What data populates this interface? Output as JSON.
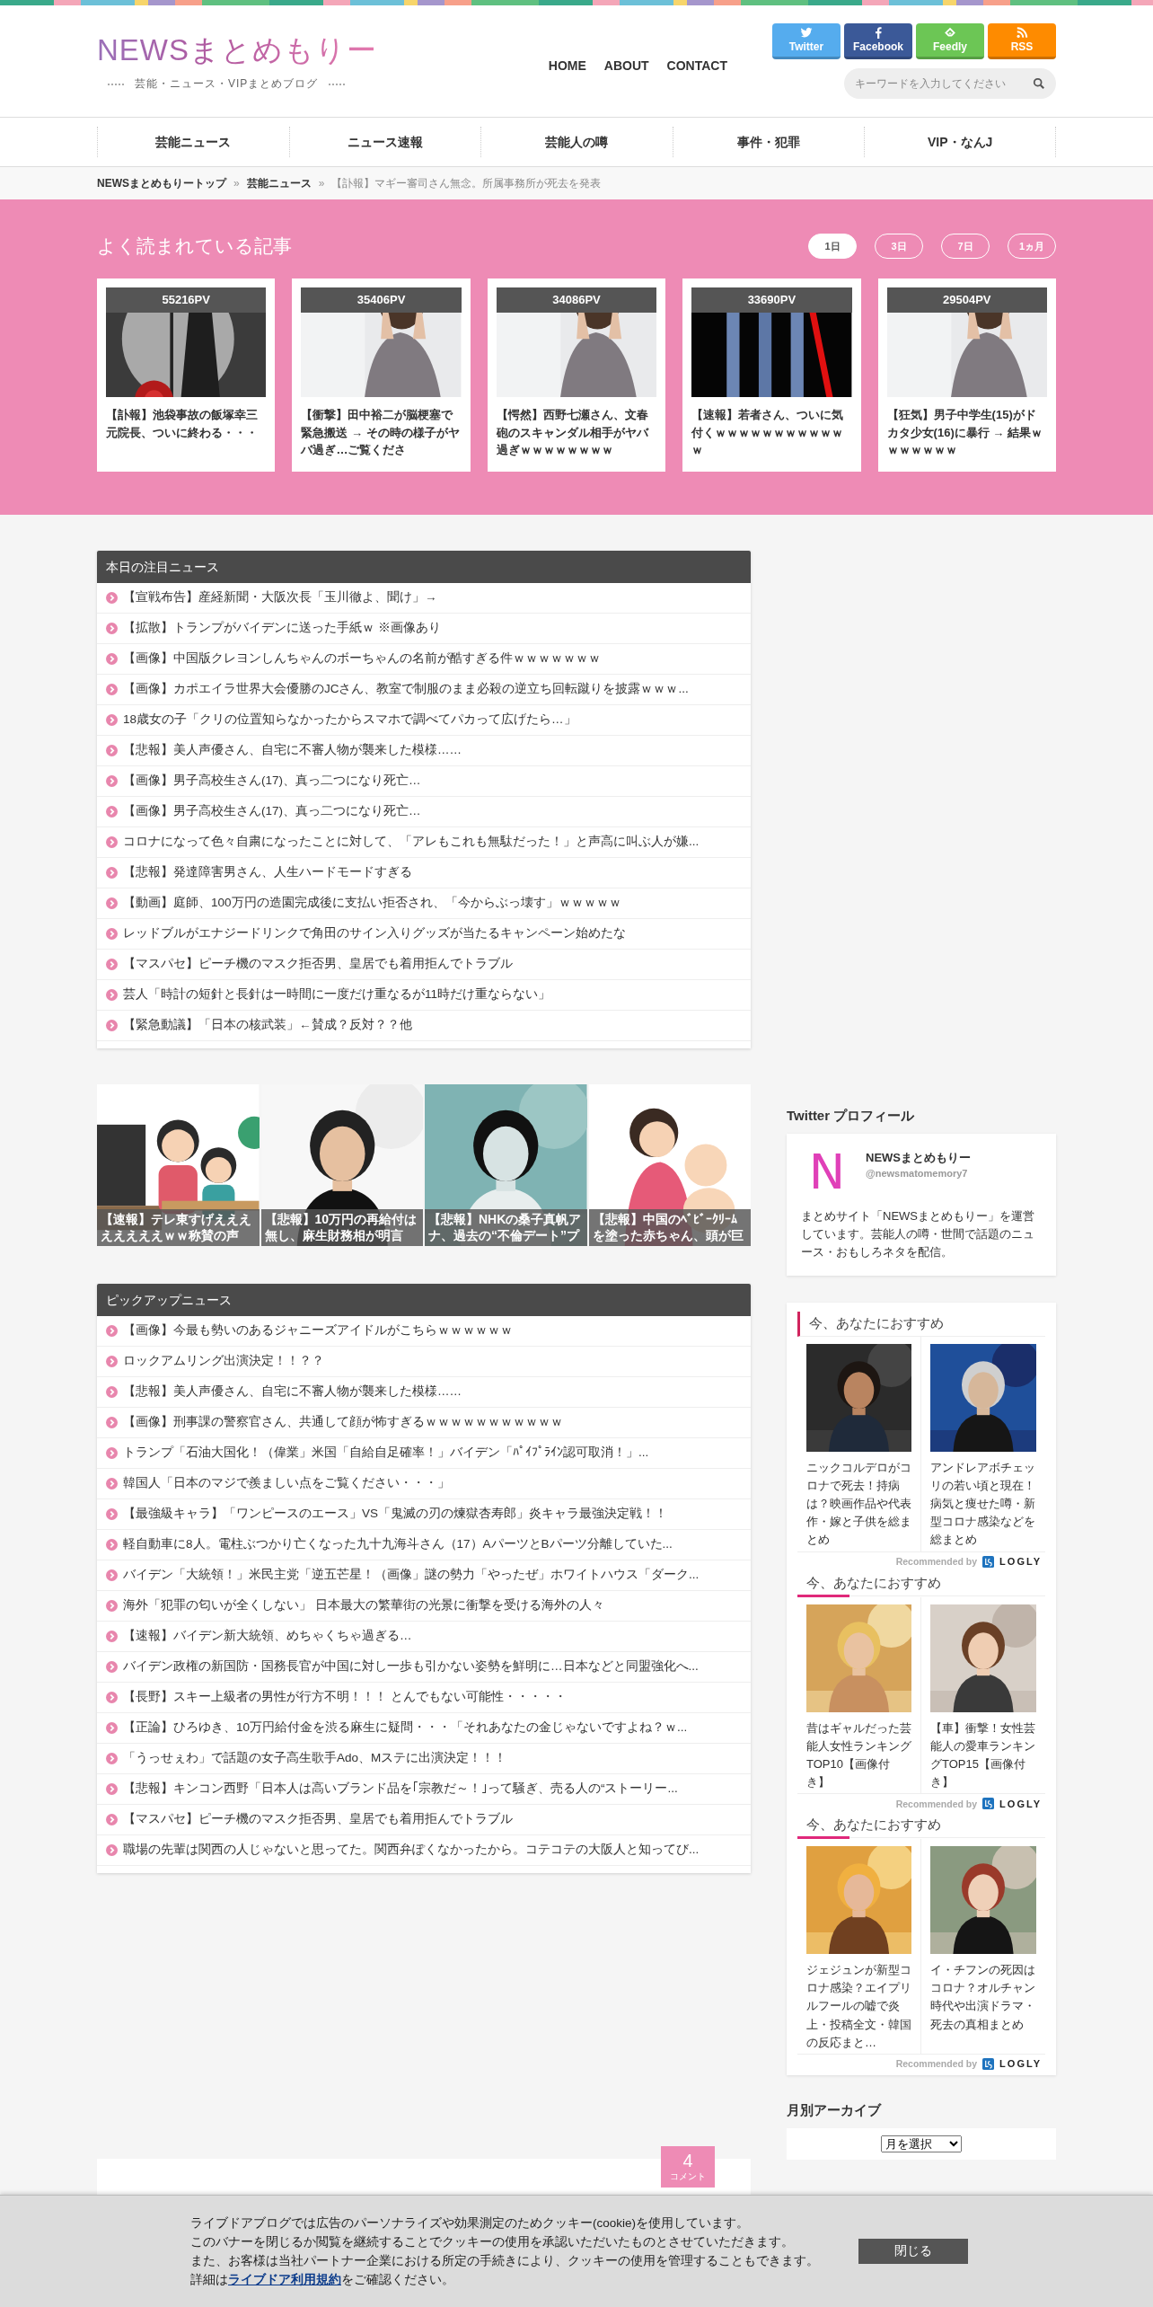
{
  "header": {
    "logo": "NEWSまとめもりー",
    "tagline": "芸能・ニュース・VIPまとめブログ",
    "links": [
      "HOME",
      "ABOUT",
      "CONTACT"
    ],
    "social": [
      {
        "kind": "twitter",
        "label": "Twitter",
        "color": "#55acee"
      },
      {
        "kind": "facebook",
        "label": "Facebook",
        "color": "#3b5998"
      },
      {
        "kind": "feedly",
        "label": "Feedly",
        "color": "#6cc655"
      },
      {
        "kind": "rss",
        "label": "RSS",
        "color": "#fe8b00"
      }
    ],
    "search": {
      "placeholder": "キーワードを入力してください"
    }
  },
  "category_nav": [
    "芸能ニュース",
    "ニュース速報",
    "芸能人の噂",
    "事件・犯罪",
    "VIP・なんJ"
  ],
  "breadcrumb": {
    "separator": "»",
    "links": [
      "NEWSまとめもりートップ",
      "芸能ニュース"
    ],
    "current": "【訃報】マギー審司さん無念。所属事務所が死去を発表"
  },
  "popular": {
    "title": "よく読まれている記事",
    "tabs": [
      {
        "label": "1日",
        "selected": true
      },
      {
        "label": "3日",
        "selected": false
      },
      {
        "label": "7日",
        "selected": false
      },
      {
        "label": "1ヵ月",
        "selected": false
      }
    ],
    "articles": [
      {
        "views": "55216PV",
        "title": "【訃報】池袋事故の飯塚幸三元院長、ついに終わる・・・"
      },
      {
        "views": "35406PV",
        "title": "【衝撃】田中裕二が脳梗塞で緊急搬送 → その時の様子がヤバ過ぎ…ご覧くださ"
      },
      {
        "views": "34086PV",
        "title": "【愕然】西野七瀬さん、文春砲のスキャンダル相手がヤバ過ぎｗｗｗｗｗｗｗｗ"
      },
      {
        "views": "33690PV",
        "title": "【速報】若者さん、ついに気付くｗｗｗｗｗｗｗｗｗｗｗｗ"
      },
      {
        "views": "29504PV",
        "title": "【狂気】男子中学生(15)がドカタ少女(16)に暴行 → 結果ｗｗｗｗｗｗｗ"
      }
    ]
  },
  "todays_news": {
    "title": "本日の注目ニュース",
    "items": [
      "【宣戦布告】産経新聞・大阪次長「玉川徹よ、聞け」→",
      "【拡散】トランプがバイデンに送った手紙ｗ ※画像あり",
      "【画像】中国版クレヨンしんちゃんのボーちゃんの名前が酷すぎる件ｗｗｗｗｗｗｗ",
      "【画像】カポエイラ世界大会優勝のJCさん、教室で制服のまま必殺の逆立ち回転蹴りを披露ｗｗｗ...",
      "18歳女の子「クリの位置知らなかったからスマホで調べてパカって広げたら…」",
      "【悲報】美人声優さん、自宅に不審人物が襲来した模様……",
      "【画像】男子高校生さん(17)、真っ二つになり死亡…",
      "【画像】男子高校生さん(17)、真っ二つになり死亡…",
      "コロナになって色々自粛になったことに対して、「アレもこれも無駄だった！」と声高に叫ぶ人が嫌...",
      "【悲報】発達障害男さん、人生ハードモードすぎる",
      "【動画】庭師、100万円の造園完成後に支払い拒否され、「今からぶっ壊す」ｗｗｗｗｗ",
      "レッドブルがエナジードリンクで角田のサイン入りグッズが当たるキャンペーン始めたな",
      "【マスパセ】ピーチ機のマスク拒否男、皇居でも着用拒んでトラブル",
      "芸人「時計の短針と長針は一時間に一度だけ重なるが11時だけ重ならない」",
      "【緊急動議】「日本の核武装」←賛成？反対？？他"
    ]
  },
  "image_strip": [
    {
      "caption": "【速報】テレ東すげええええええええｗｗ称賛の声"
    },
    {
      "caption": "【悲報】10万円の再給付は無し、麻生財務相が明言"
    },
    {
      "caption": "【悲報】NHKの桑子真帆アナ、過去の“不倫デート”プ"
    },
    {
      "caption": "【悲報】中国のﾍﾞﾋﾞｰｸﾘｰﾑを塗った赤ちゃん、頭が巨"
    }
  ],
  "pickup_news": {
    "title": "ピックアップニュース",
    "items": [
      "【画像】今最も勢いのあるジャニーズアイドルがこちらｗｗｗｗｗｗ",
      "ロックアムリング出演決定！！？？",
      "【悲報】美人声優さん、自宅に不審人物が襲来した模様……",
      "【画像】刑事課の警察官さん、共通して顔が怖すぎるｗｗｗｗｗｗｗｗｗｗｗ",
      "トランプ「石油大国化！（偉業」米国「自給自足確率！」バイデン「ﾊﾟｲﾌﾟﾗｲﾝ認可取消！」...",
      "韓国人「日本のマジで羨ましい点をご覧ください・・・」",
      "【最強級キャラ】「ワンピースのエース」VS「鬼滅の刃の煉獄杏寿郎」炎キャラ最強決定戦！！",
      "軽自動車に8人。電柱ぶつかり亡くなった九十九海斗さん（17）AパーツとBパーツ分離していた...",
      "バイデン「大統領！」米民主党「逆五芒星！（画像」謎の勢力「やったぜ」ホワイトハウス「ダーク...",
      "海外「犯罪の匂いが全くしない」 日本最大の繁華街の光景に衝撃を受ける海外の人々",
      "【速報】バイデン新大統領、めちゃくちゃ過ぎる…",
      "バイデン政権の新国防・国務長官が中国に対し一歩も引かない姿勢を鮮明に…日本などと同盟強化へ...",
      "【長野】スキー上級者の男性が行方不明！！！ とんでもない可能性・・・・・",
      "【正論】ひろゆき、10万円給付金を渋る麻生に疑問・・・「それあなたの金じゃないですよね？ｗ...",
      "「うっせぇわ」で話題の女子高生歌手Ado、Mステに出演決定！！！",
      "【悲報】キンコン西野「日本人は高いブランド品を｢宗教だ～！｣って騒ぎ、売る人の“ストーリー...",
      "【マスパセ】ピーチ機のマスク拒否男、皇居でも着用拒んでトラブル",
      "職場の先輩は関西の人じゃないと思ってた。関西弁ぽくなかったから。コテコテの大阪人と知ってび..."
    ]
  },
  "article": {
    "comments": {
      "count": "4",
      "label": "コメント"
    }
  },
  "twitter_profile": {
    "title": "Twitter プロフィール",
    "avatar_letter": "N",
    "name": "NEWSまとめもりー",
    "handle": "@newsmatomemory7",
    "bio": "まとめサイト「NEWSまとめもりー」を運営しています。芸能人の噂・世間で話題のニュース・おもしろネタを配信。"
  },
  "recommendations": [
    {
      "heading": "今、あなたにおすすめ",
      "kind": "bar",
      "items": [
        {
          "title": "ニックコルデロがコロナで死去！持病は？映画作品や代表作・嫁と子供を総まとめ"
        },
        {
          "title": "アンドレアボチェッリの若い頃と現在！病気と痩せた噂・新型コロナ感染などを総まとめ"
        }
      ],
      "credit": "Recommended by",
      "brand": "LOGLY"
    },
    {
      "heading": "今、あなたにおすすめ",
      "kind": "underline",
      "items": [
        {
          "title": "昔はギャルだった芸能人女性ランキングTOP10【画像付き】"
        },
        {
          "title": "【車】衝撃！女性芸能人の愛車ランキングTOP15【画像付き】"
        }
      ],
      "credit": "Recommended by",
      "brand": "LOGLY"
    },
    {
      "heading": "今、あなたにおすすめ",
      "kind": "underline",
      "items": [
        {
          "title": "ジェジュンが新型コロナ感染？エイプリルフールの嘘で炎上・投稿全文・韓国の反応まと…"
        },
        {
          "title": "イ・チフンの死因はコロナ？オルチャン時代や出演ドラマ・死去の真相まとめ"
        }
      ],
      "credit": "Recommended by",
      "brand": "LOGLY"
    }
  ],
  "archive": {
    "title": "月別アーカイブ",
    "select": "月を選択"
  },
  "cookie_banner": {
    "lines": [
      "ライブドアブログでは広告のパーソナライズや効果測定のためクッキー(cookie)を使用しています。",
      "このバナーを閉じるか閲覧を継続することでクッキーの使用を承認いただいたものとさせていただきます。",
      "また、お客様は当社パートナー企業における所定の手続きにより、クッキーの使用を管理することもできます。"
    ],
    "last_line": {
      "before": "詳細は",
      "link": "ライブドア利用規約",
      "after": "をご確認ください。"
    },
    "button": "閉じる"
  }
}
